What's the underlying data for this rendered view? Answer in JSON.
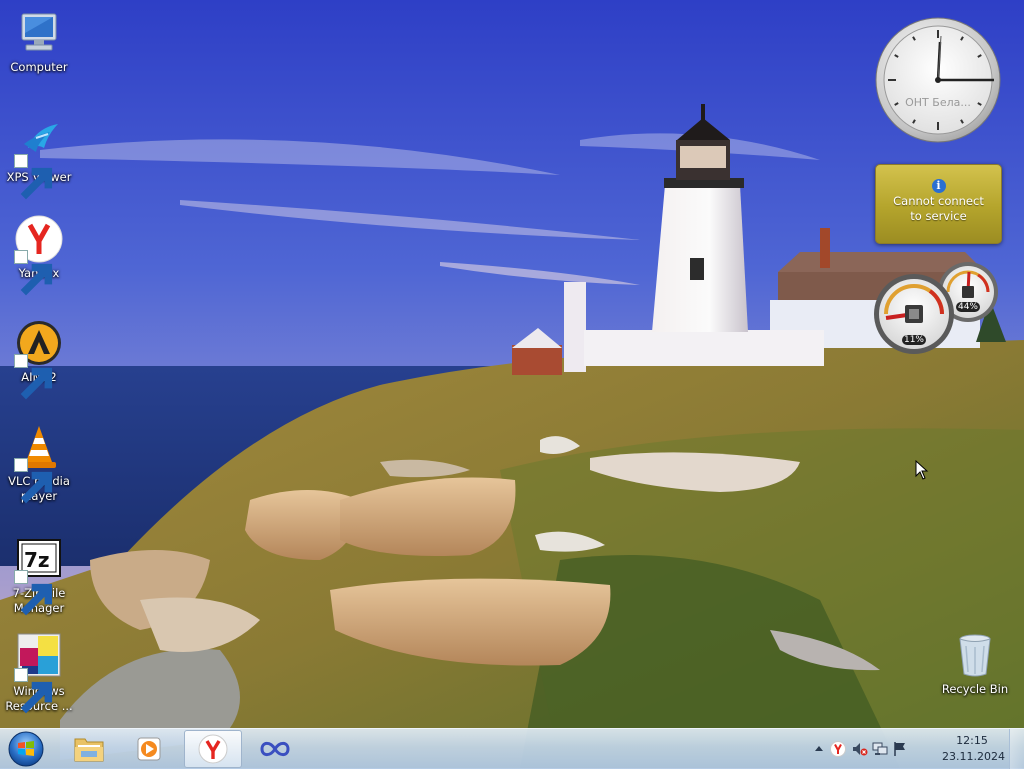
{
  "desktop": {
    "icons": [
      {
        "label": "Computer",
        "icon": "computer-icon"
      },
      {
        "label": "XPS Viewer",
        "icon": "xps-viewer-icon"
      },
      {
        "label": "Yandex",
        "icon": "yandex-browser-icon"
      },
      {
        "label": "AIMP2",
        "icon": "aimp-icon"
      },
      {
        "label": "VLC media player",
        "icon": "vlc-cone-icon"
      },
      {
        "label": "7-Zip File Manager",
        "icon": "7zip-icon"
      },
      {
        "label": "Windows Resource ...",
        "icon": "windows-resource-icon"
      },
      {
        "label": "Recycle Bin",
        "icon": "recycle-bin-icon"
      }
    ]
  },
  "gadgets": {
    "clock": {
      "caption": "ОНТ Бела...",
      "time": "12:15"
    },
    "weather": {
      "message": "Cannot connect to service",
      "icon": "info-icon"
    },
    "cpu_meter": {
      "cpu_percent": "11%",
      "memory_percent": "44%",
      "cpu_value": 0.11,
      "memory_value": 0.44
    }
  },
  "taskbar": {
    "start": {
      "icon": "windows-start-orb-icon"
    },
    "pinned": [
      {
        "name": "Windows Explorer",
        "icon": "folder-icon"
      },
      {
        "name": "Media Player",
        "icon": "media-player-icon"
      },
      {
        "name": "Yandex",
        "icon": "yandex-browser-icon",
        "active": true
      },
      {
        "name": "Infinity",
        "icon": "infinity-icon"
      }
    ],
    "tray": {
      "icons": [
        "show-hidden-icons-icon",
        "yandex-tray-icon",
        "volume-muted-icon",
        "network-icon",
        "action-center-flag-icon"
      ],
      "time": "12:15",
      "date": "23.11.2024"
    }
  },
  "colors": {
    "taskbar": "#c4d7eb",
    "weather_gadget": "#b4a42c",
    "yandex_red": "#e52620",
    "vlc_orange": "#f08a00"
  }
}
